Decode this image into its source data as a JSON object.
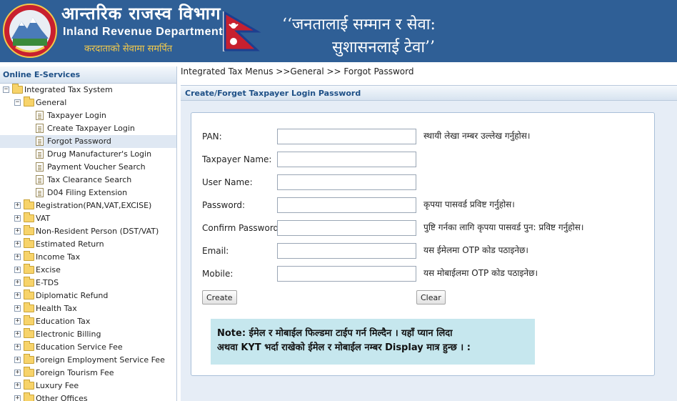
{
  "header": {
    "dept_np": "आन्तरिक राजस्व विभाग",
    "dept_en": "Inland Revenue Department",
    "tagline": "करदाताको सेवामा समर्पित",
    "motto_line1": "‘‘जनतालाई सम्मान र सेवा:",
    "motto_line2": "सुशासनलाई टेवा’’",
    "colors": {
      "bg": "#2f5f96",
      "tagline": "#f2c94c"
    }
  },
  "sidebar": {
    "title": "Online E-Services",
    "tree": [
      {
        "label": "Integrated Tax System",
        "level": 0,
        "type": "folder",
        "expanded": true
      },
      {
        "label": "General",
        "level": 1,
        "type": "folder",
        "expanded": true
      },
      {
        "label": "Taxpayer Login",
        "level": 2,
        "type": "doc"
      },
      {
        "label": "Create Taxpayer Login",
        "level": 2,
        "type": "doc"
      },
      {
        "label": "Forgot Password",
        "level": 2,
        "type": "doc",
        "selected": true
      },
      {
        "label": "Drug Manufacturer's Login",
        "level": 2,
        "type": "doc"
      },
      {
        "label": "Payment Voucher Search",
        "level": 2,
        "type": "doc"
      },
      {
        "label": "Tax Clearance Search",
        "level": 2,
        "type": "doc"
      },
      {
        "label": "D04 Filing Extension",
        "level": 2,
        "type": "doc"
      },
      {
        "label": "Registration(PAN,VAT,EXCISE)",
        "level": 1,
        "type": "folder",
        "expanded": false
      },
      {
        "label": "VAT",
        "level": 1,
        "type": "folder",
        "expanded": false
      },
      {
        "label": "Non-Resident Person (DST/VAT)",
        "level": 1,
        "type": "folder",
        "expanded": false
      },
      {
        "label": "Estimated Return",
        "level": 1,
        "type": "folder",
        "expanded": false
      },
      {
        "label": "Income Tax",
        "level": 1,
        "type": "folder",
        "expanded": false
      },
      {
        "label": "Excise",
        "level": 1,
        "type": "folder",
        "expanded": false
      },
      {
        "label": "E-TDS",
        "level": 1,
        "type": "folder",
        "expanded": false
      },
      {
        "label": "Diplomatic Refund",
        "level": 1,
        "type": "folder",
        "expanded": false
      },
      {
        "label": "Health Tax",
        "level": 1,
        "type": "folder",
        "expanded": false
      },
      {
        "label": "Education Tax",
        "level": 1,
        "type": "folder",
        "expanded": false
      },
      {
        "label": "Electronic Billing",
        "level": 1,
        "type": "folder",
        "expanded": false
      },
      {
        "label": "Education Service Fee",
        "level": 1,
        "type": "folder",
        "expanded": false
      },
      {
        "label": "Foreign Employment Service Fee",
        "level": 1,
        "type": "folder",
        "expanded": false
      },
      {
        "label": "Foreign Tourism Fee",
        "level": 1,
        "type": "folder",
        "expanded": false
      },
      {
        "label": "Luxury Fee",
        "level": 1,
        "type": "folder",
        "expanded": false
      },
      {
        "label": "Other Offices",
        "level": 1,
        "type": "folder",
        "expanded": false
      }
    ]
  },
  "main": {
    "breadcrumb": "Integrated Tax Menus >>General >> Forgot Password",
    "panel_title": "Create/Forget Taxpayer Login Password",
    "fields": [
      {
        "key": "pan",
        "label": "PAN:",
        "value": "",
        "hint": "स्थायी लेखा नम्बर उल्लेख गर्नुहोस।"
      },
      {
        "key": "taxpayer_name",
        "label": "Taxpayer Name:",
        "value": "",
        "hint": ""
      },
      {
        "key": "user_name",
        "label": "User Name:",
        "value": "",
        "hint": ""
      },
      {
        "key": "password",
        "label": "Password:",
        "value": "",
        "hint": "कृपया पासवर्ड प्रविष्ट गर्नुहोस।"
      },
      {
        "key": "confirm_password",
        "label": "Confirm Password:",
        "value": "",
        "hint": "पुष्टि गर्नका लागि कृपया पासवर्ड पुन: प्रविष्ट गर्नुहोस।"
      },
      {
        "key": "email",
        "label": "Email:",
        "value": "",
        "hint": "यस ईमेलमा OTP कोड पठाइनेछ।"
      },
      {
        "key": "mobile",
        "label": "Mobile:",
        "value": "",
        "hint": "यस मोबाईलमा OTP कोड पठाइनेछ।"
      }
    ],
    "create_label": "Create",
    "clear_label": "Clear",
    "note_line1": "Note: ईमेल र मोबाईल फिल्डमा टाईप गर्न मिल्दैन । यहाँ प्यान लिदा",
    "note_line2": "अथवा KYT भर्दा राखेको ईमेल र मोबाईल नम्बर Display मात्र हुन्छ । :"
  }
}
